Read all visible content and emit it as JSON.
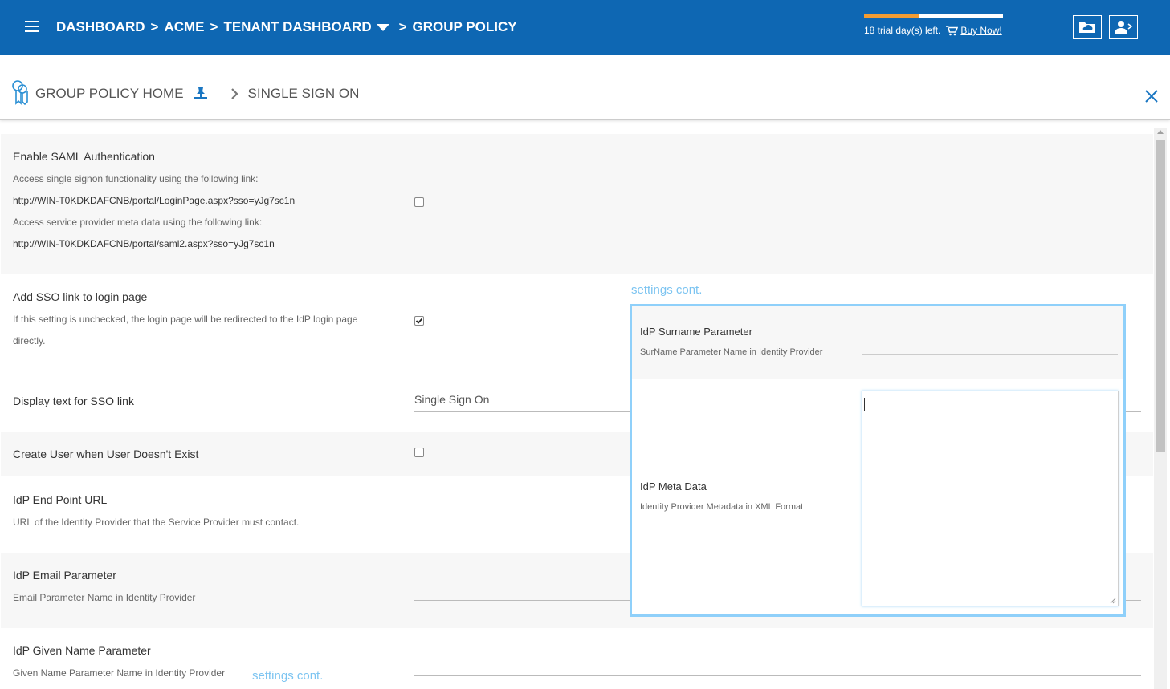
{
  "header": {
    "breadcrumb": [
      {
        "label": "DASHBOARD"
      },
      {
        "label": "ACME"
      },
      {
        "label": "TENANT DASHBOARD"
      },
      {
        "label": "GROUP POLICY"
      }
    ],
    "separator": ">",
    "trial_text": "18 trial day(s) left.",
    "trial_progress": 0.4,
    "buy_label": "Buy Now!",
    "accent_color": "#0e67b3",
    "progress_color": "#f39c32",
    "icons": [
      "menu-icon",
      "cart-icon",
      "folder-cloud-icon",
      "user-switch-icon"
    ]
  },
  "subheader": {
    "home_label": "GROUP POLICY HOME",
    "current_label": "SINGLE SIGN ON",
    "icons": [
      "group-policy-icon",
      "pin-icon",
      "chevron-right-icon",
      "close-icon"
    ]
  },
  "settings": {
    "saml": {
      "title": "Enable SAML Authentication",
      "desc1": "Access single signon functionality using the following link:",
      "link1": "http://WIN-T0KDKDAFCNB/portal/LoginPage.aspx?sso=yJg7sc1n",
      "desc2": "Access service provider meta data using the following link:",
      "link2": "http://WIN-T0KDKDAFCNB/portal/saml2.aspx?sso=yJg7sc1n",
      "checked": false
    },
    "sso_link": {
      "title": "Add SSO link to login page",
      "desc_line1": "If this setting is unchecked, the login page will be redirected to the IdP login page",
      "desc_line2": "directly.",
      "checked": true
    },
    "display_text": {
      "title": "Display text for SSO link",
      "value": "Single Sign On"
    },
    "create_user": {
      "title": "Create User when User Doesn't Exist",
      "checked": false
    },
    "idp_endpoint": {
      "title": "IdP End Point URL",
      "desc": "URL of the Identity Provider that the Service Provider must contact."
    },
    "idp_email": {
      "title": "IdP Email Parameter",
      "desc": "Email Parameter Name in Identity Provider"
    },
    "idp_given": {
      "title": "IdP Given Name Parameter",
      "desc": "Given Name Parameter Name in Identity Provider"
    }
  },
  "overlay": {
    "label": "settings cont.",
    "bottom_label": "settings cont.",
    "surname_title": "IdP Surname Parameter",
    "surname_desc": "SurName Parameter Name in Identity Provider",
    "meta_title": "IdP Meta Data",
    "meta_desc": "Identity Provider Metadata in XML Format",
    "border_color": "#8fd0fa"
  }
}
